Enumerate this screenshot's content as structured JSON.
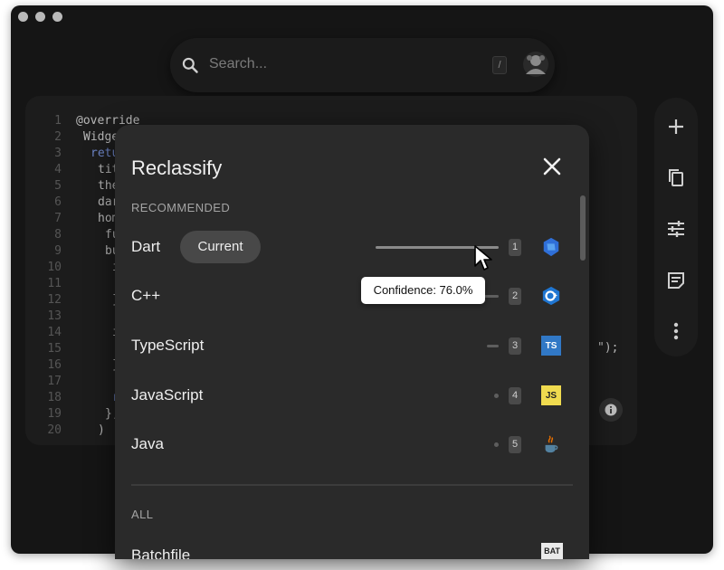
{
  "search": {
    "placeholder": "Search...",
    "shortcut_key": "/"
  },
  "code": {
    "line_numbers": [
      "1",
      "2",
      "3",
      "4",
      "5",
      "6",
      "7",
      "8",
      "9",
      "10",
      "11",
      "12",
      "13",
      "14",
      "15",
      "16",
      "17",
      "18",
      "19",
      "20"
    ],
    "lines": [
      "@override",
      "Widget",
      "return",
      "title",
      "theme",
      "dark",
      "home",
      "fu",
      "bu",
      "i",
      "",
      "}",
      "",
      "i",
      "",
      "}",
      "",
      "r",
      "},",
      ")"
    ],
    "tail_text": "\");"
  },
  "dialog": {
    "title": "Reclassify",
    "recommended_label": "RECOMMENDED",
    "all_label": "ALL",
    "current_chip": "Current",
    "recommended": [
      {
        "name": "Dart",
        "key": "1",
        "icon": "dart-icon",
        "confidence": 76.0,
        "current": true
      },
      {
        "name": "C++",
        "key": "2",
        "icon": "cpp-icon"
      },
      {
        "name": "TypeScript",
        "key": "3",
        "icon": "typescript-icon",
        "icon_text": "TS"
      },
      {
        "name": "JavaScript",
        "key": "4",
        "icon": "javascript-icon",
        "icon_text": "JS"
      },
      {
        "name": "Java",
        "key": "5",
        "icon": "java-icon"
      }
    ],
    "all": [
      {
        "name": "Batchfile",
        "icon": "batchfile-icon",
        "icon_text": "BAT"
      }
    ]
  },
  "tooltip": {
    "text": "Confidence: 76.0%"
  },
  "colors": {
    "window_bg": "#151515",
    "dialog_bg": "#2a2a2a",
    "ts_blue": "#3178c6",
    "js_yellow": "#f0db4f",
    "dart_blue": "#2f6fd8"
  }
}
